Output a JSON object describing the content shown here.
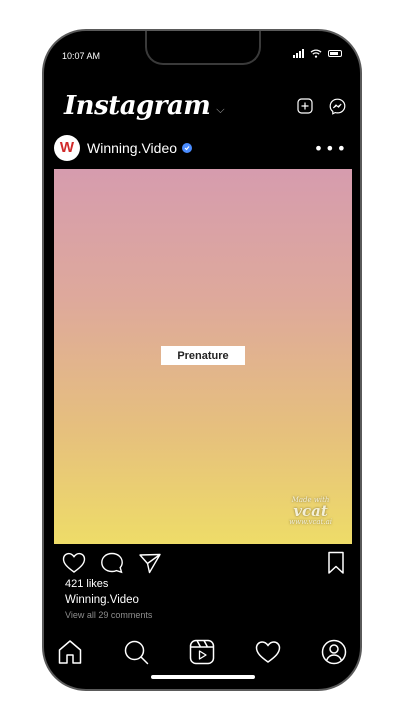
{
  "status": {
    "time": "10:07 AM"
  },
  "header": {
    "logo": "Instagram",
    "chevron": "⌵"
  },
  "post": {
    "username": "Winning.Video",
    "avatar_letter": "W",
    "more": "•••",
    "media_label": "Prenature",
    "watermark": {
      "line1": "Made with",
      "line2": "vcat",
      "line3": "www.vcat.ai"
    },
    "likes": "421 likes",
    "caption_user": "Winning.Video",
    "comments": "View all 29 comments"
  },
  "colors": {
    "background": "#000000",
    "gradient_top": "#d69cae",
    "gradient_bottom": "#eedc68",
    "verified": "#4a8cff",
    "avatar_accent": "#d12a2a"
  },
  "icons": {
    "header": [
      "new-post-icon",
      "messenger-icon"
    ],
    "actions": [
      "heart-icon",
      "comment-icon",
      "share-icon",
      "bookmark-icon"
    ],
    "tabbar": [
      "home-icon",
      "search-icon",
      "reels-icon",
      "activity-icon",
      "profile-icon"
    ]
  }
}
